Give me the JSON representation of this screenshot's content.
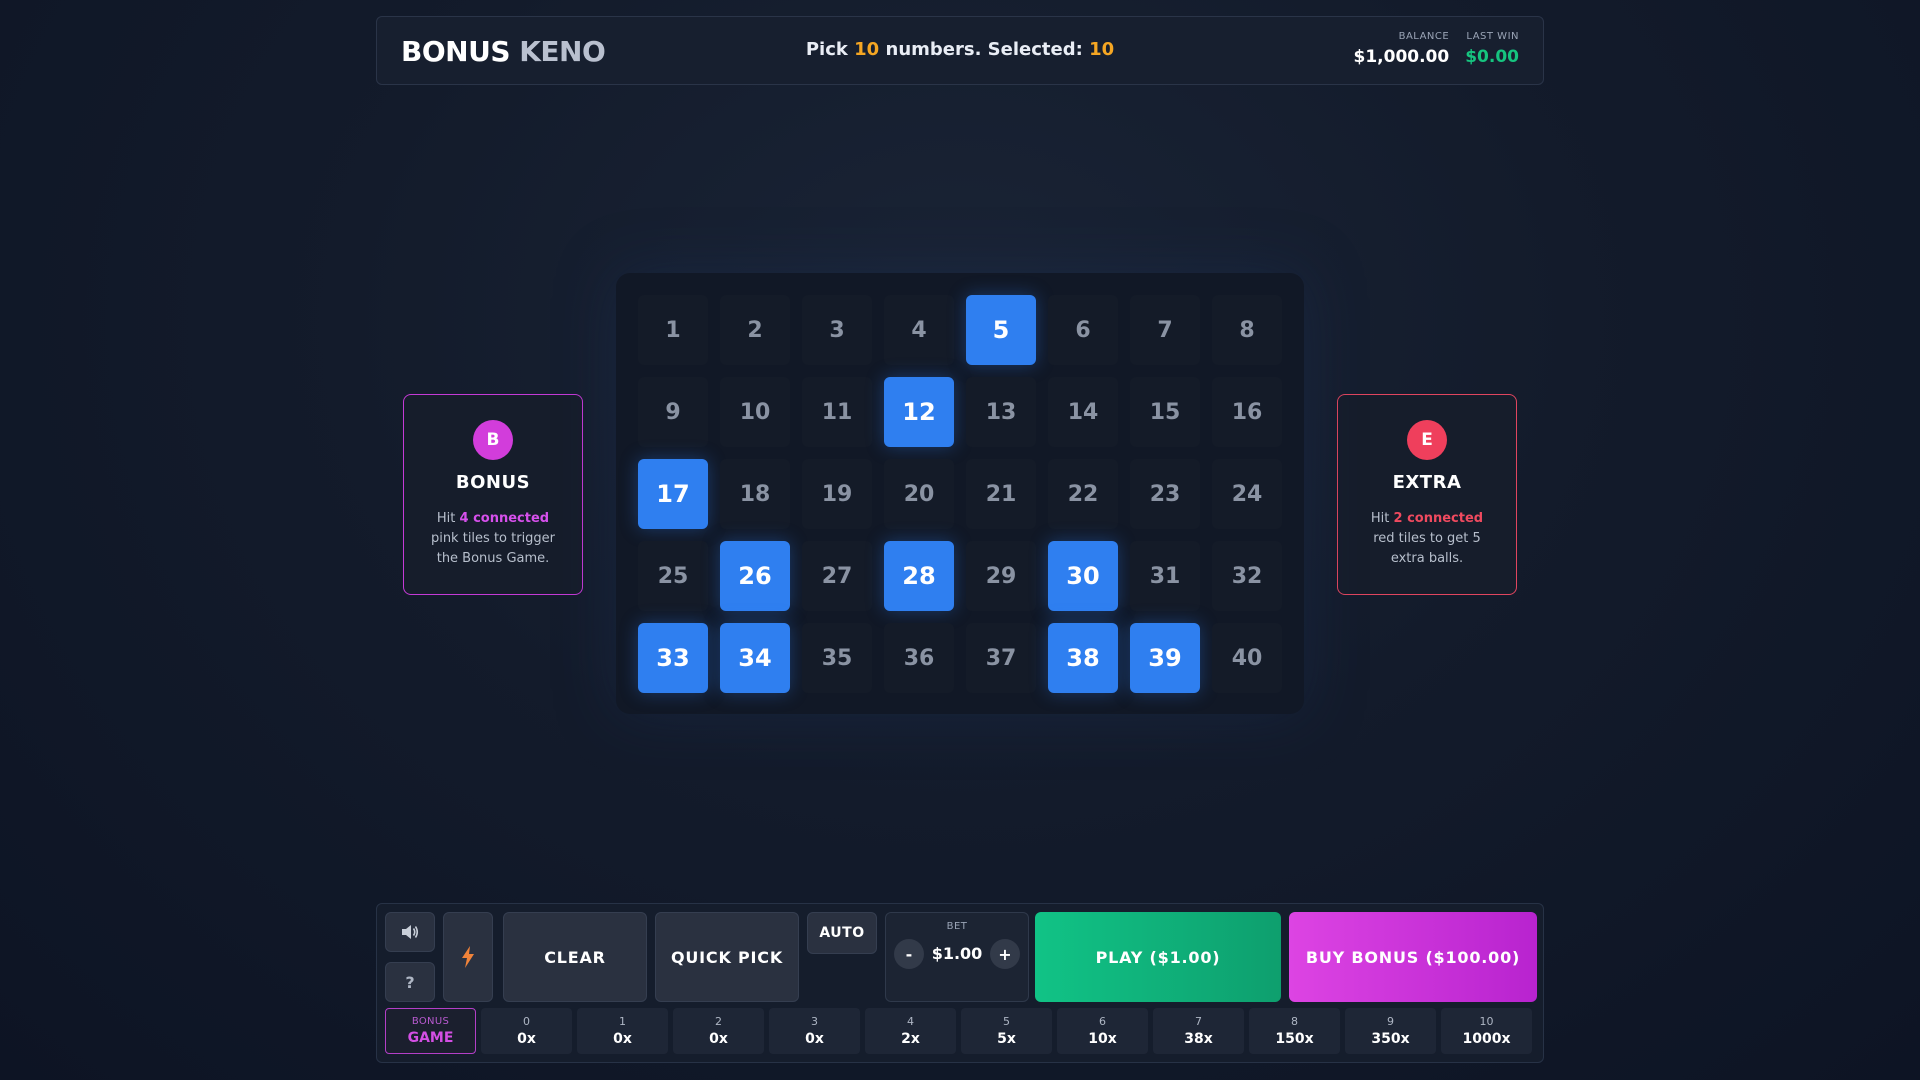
{
  "header": {
    "title_part1": "BONUS",
    "title_part2": "KENO",
    "status_prefix": "Pick",
    "pick_count": "10",
    "status_middle": "numbers. Selected:",
    "selected_count": "10",
    "balance_label": "BALANCE",
    "balance_value": "$1,000.00",
    "last_win_label": "LAST WIN",
    "last_win_value": "$0.00"
  },
  "board": {
    "numbers": [
      1,
      2,
      3,
      4,
      5,
      6,
      7,
      8,
      9,
      10,
      11,
      12,
      13,
      14,
      15,
      16,
      17,
      18,
      19,
      20,
      21,
      22,
      23,
      24,
      25,
      26,
      27,
      28,
      29,
      30,
      31,
      32,
      33,
      34,
      35,
      36,
      37,
      38,
      39,
      40
    ],
    "selected": [
      5,
      12,
      17,
      26,
      28,
      30,
      33,
      34,
      38,
      39
    ]
  },
  "bonus_card": {
    "badge": "B",
    "title": "BONUS",
    "desc_before": "Hit",
    "desc_highlight": "4 connected",
    "desc_after": "pink tiles to trigger the Bonus Game."
  },
  "extra_card": {
    "badge": "E",
    "title": "EXTRA",
    "desc_before": "Hit",
    "desc_highlight": "2 connected",
    "desc_after": "red tiles to get 5 extra balls."
  },
  "controls": {
    "help_label": "?",
    "clear_label": "CLEAR",
    "quick_pick_label": "QUICK PICK",
    "auto_label": "AUTO",
    "bet_label": "BET",
    "bet_value": "$1.00",
    "minus_label": "-",
    "plus_label": "+",
    "play_label": "PLAY ($1.00)",
    "buy_bonus_label": "BUY BONUS ($100.00)"
  },
  "paytable": {
    "bonus_game_line1": "BONUS",
    "bonus_game_line2": "GAME",
    "entries": [
      {
        "hits": "0",
        "multiplier": "0x"
      },
      {
        "hits": "1",
        "multiplier": "0x"
      },
      {
        "hits": "2",
        "multiplier": "0x"
      },
      {
        "hits": "3",
        "multiplier": "0x"
      },
      {
        "hits": "4",
        "multiplier": "2x"
      },
      {
        "hits": "5",
        "multiplier": "5x"
      },
      {
        "hits": "6",
        "multiplier": "10x"
      },
      {
        "hits": "7",
        "multiplier": "38x"
      },
      {
        "hits": "8",
        "multiplier": "150x"
      },
      {
        "hits": "9",
        "multiplier": "350x"
      },
      {
        "hits": "10",
        "multiplier": "1000x"
      }
    ]
  },
  "colors": {
    "selected_tile": "#2f7ff0",
    "accent_orange": "#f5a623",
    "win_green": "#16c47f",
    "bonus_pink": "#d23ddb",
    "extra_red": "#ef3f5c"
  },
  "icons": {
    "sound": "speaker-icon",
    "turbo": "lightning-icon"
  }
}
